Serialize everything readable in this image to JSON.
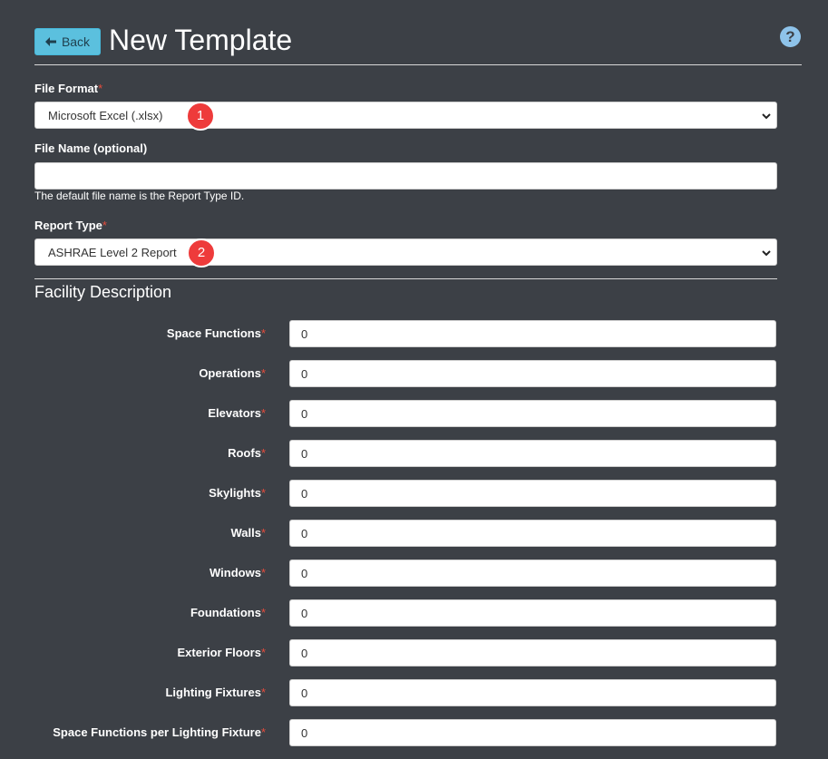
{
  "header": {
    "back_label": "Back",
    "title": "New Template"
  },
  "form": {
    "file_format": {
      "label": "File Format",
      "required_mark": "*",
      "value": "Microsoft Excel (.xlsx)"
    },
    "file_name": {
      "label": "File Name (optional)",
      "value": "",
      "help": "The default file name is the Report Type ID."
    },
    "report_type": {
      "label": "Report Type",
      "required_mark": "*",
      "value": "ASHRAE Level 2 Report"
    }
  },
  "badges": [
    "1",
    "2"
  ],
  "facility": {
    "title": "Facility Description",
    "rows": [
      {
        "label": "Space Functions",
        "req": "*",
        "value": "0"
      },
      {
        "label": "Operations",
        "req": "*",
        "value": "0"
      },
      {
        "label": "Elevators",
        "req": "*",
        "value": "0"
      },
      {
        "label": "Roofs",
        "req": "*",
        "value": "0"
      },
      {
        "label": "Skylights",
        "req": "*",
        "value": "0"
      },
      {
        "label": "Walls",
        "req": "*",
        "value": "0"
      },
      {
        "label": "Windows",
        "req": "*",
        "value": "0"
      },
      {
        "label": "Foundations",
        "req": "*",
        "value": "0"
      },
      {
        "label": "Exterior Floors",
        "req": "*",
        "value": "0"
      },
      {
        "label": "Lighting Fixtures",
        "req": "*",
        "value": "0"
      },
      {
        "label": "Space Functions per Lighting Fixture",
        "req": "*",
        "value": "0"
      }
    ]
  },
  "icons": {
    "back": "arrow-left-icon",
    "help": "question-circle-icon",
    "select": "chevron-down-icon"
  },
  "colors": {
    "background": "#3c4046",
    "back_button": "#5bc0de",
    "required": "#e74c3c",
    "badge": "#ee3b3b",
    "help_icon": "#8ec3ea"
  }
}
